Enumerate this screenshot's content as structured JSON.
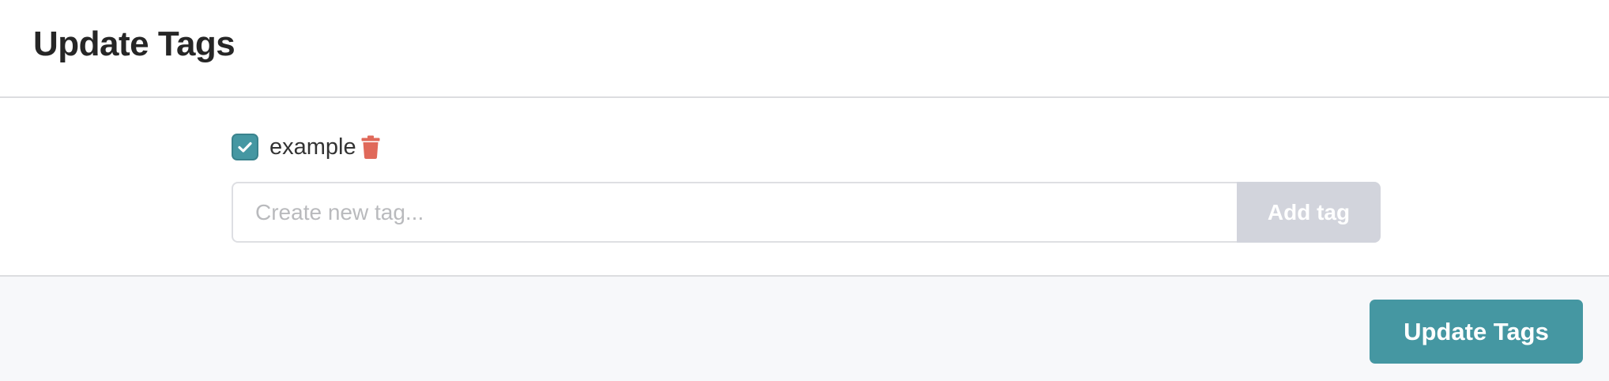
{
  "header": {
    "title": "Update Tags"
  },
  "tags": {
    "items": [
      {
        "label": "example",
        "checked": true
      }
    ]
  },
  "new_tag": {
    "placeholder": "Create new tag...",
    "value": "",
    "add_label": "Add tag"
  },
  "footer": {
    "submit_label": "Update Tags"
  },
  "colors": {
    "accent": "#4597a2",
    "delete": "#e0695a",
    "disabled_button": "#d2d4dc"
  },
  "icons": {
    "checkbox": "check-icon",
    "delete": "trash-icon"
  }
}
